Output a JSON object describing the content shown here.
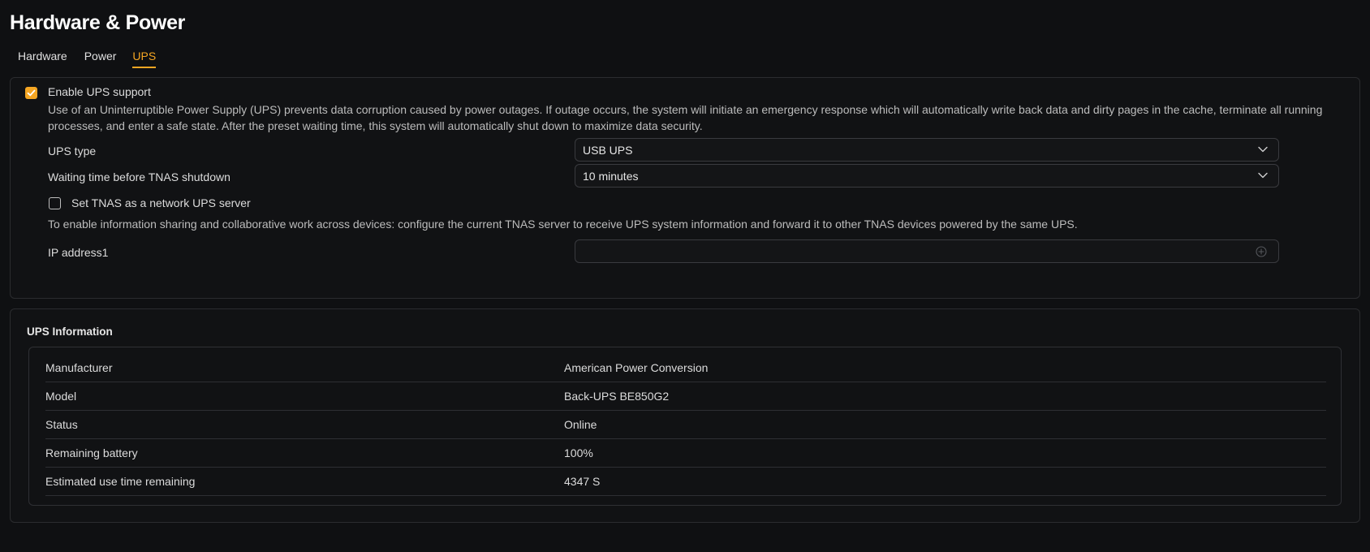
{
  "page": {
    "title": "Hardware & Power"
  },
  "tabs": [
    {
      "label": "Hardware",
      "active": false
    },
    {
      "label": "Power",
      "active": false
    },
    {
      "label": "UPS",
      "active": true
    }
  ],
  "ups_settings": {
    "enable_label": "Enable UPS support",
    "enable_checked": true,
    "description": "Use of an Uninterruptible Power Supply (UPS) prevents data corruption caused by power outages. If outage occurs, the system will initiate an emergency response which will automatically write back data and dirty pages in the cache, terminate all running processes, and enter a safe state. After the preset waiting time, this system will automatically shut down to maximize data security.",
    "ups_type_label": "UPS type",
    "ups_type_value": "USB UPS",
    "waiting_time_label": "Waiting time before TNAS shutdown",
    "waiting_time_value": "10 minutes",
    "network_server_label": "Set TNAS as a network UPS server",
    "network_server_checked": false,
    "network_server_description": "To enable information sharing and collaborative work across devices: configure the current TNAS server to receive UPS system information and forward it to other TNAS devices powered by the same UPS.",
    "ip_address_label": "IP address1",
    "ip_address_value": ""
  },
  "ups_information": {
    "title": "UPS Information",
    "rows": [
      {
        "key": "Manufacturer",
        "value": "American Power Conversion"
      },
      {
        "key": "Model",
        "value": "Back-UPS BE850G2"
      },
      {
        "key": "Status",
        "value": "Online"
      },
      {
        "key": "Remaining battery",
        "value": "100%"
      },
      {
        "key": "Estimated use time remaining",
        "value": "4347 S"
      }
    ]
  },
  "colors": {
    "accent": "#f5a623",
    "background": "#0f1012",
    "border": "#2b2c2f"
  },
  "icons": {
    "checkbox_check": "check-icon",
    "select_arrow": "chevron-down-icon",
    "add": "plus-circle-icon"
  }
}
